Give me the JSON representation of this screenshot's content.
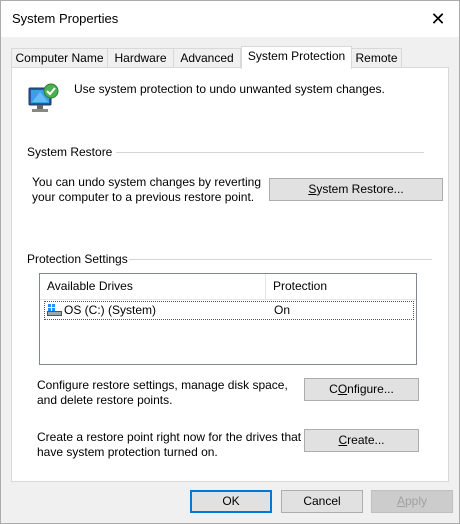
{
  "window": {
    "title": "System Properties",
    "close_glyph": "✕"
  },
  "tabs": [
    {
      "label": "Computer Name",
      "active": false
    },
    {
      "label": "Hardware",
      "active": false
    },
    {
      "label": "Advanced",
      "active": false
    },
    {
      "label": "System Protection",
      "active": true
    },
    {
      "label": "Remote",
      "active": false
    }
  ],
  "intro": {
    "text": "Use system protection to undo unwanted system changes.",
    "icon": "system-protection-icon"
  },
  "system_restore": {
    "heading": "System Restore",
    "description_line1": "You can undo system changes by reverting",
    "description_line2": "your computer to a previous restore point.",
    "button": {
      "mnemonic": "S",
      "rest": "ystem Restore..."
    }
  },
  "protection_settings": {
    "heading": "Protection Settings",
    "columns": [
      "Available Drives",
      "Protection"
    ],
    "drives": [
      {
        "name": "OS (C:) (System)",
        "protection": "On",
        "icon": "drive-icon"
      }
    ],
    "configure_text_line1": "Configure restore settings, manage disk space,",
    "configure_text_line2": "and delete restore points.",
    "configure_button": {
      "mnemonic": "O",
      "pre": "C",
      "rest": "nfigure..."
    },
    "create_text_line1": "Create a restore point right now for the drives that",
    "create_text_line2": "have system protection turned on.",
    "create_button": {
      "pre": "",
      "mnemonic": "C",
      "rest": "reate..."
    }
  },
  "footer": {
    "ok": "OK",
    "cancel": "Cancel",
    "apply": {
      "mnemonic": "A",
      "rest": "pply"
    }
  },
  "colors": {
    "accent": "#0078d7",
    "window_bg": "#f0f0f0",
    "panel_bg": "#ffffff"
  }
}
